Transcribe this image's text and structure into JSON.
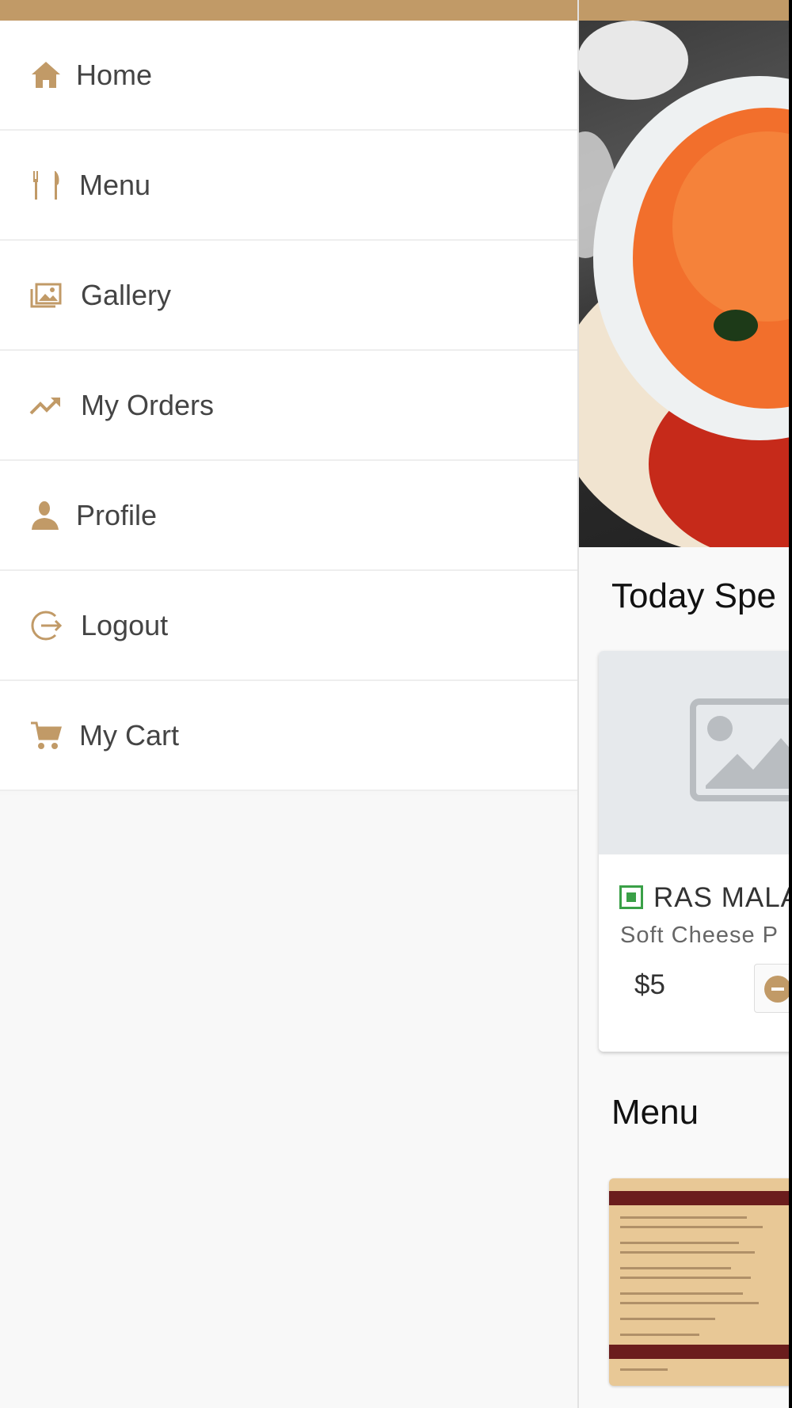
{
  "drawer": {
    "items": [
      {
        "label": "Home",
        "icon": "home-icon"
      },
      {
        "label": "Menu",
        "icon": "cutlery-icon"
      },
      {
        "label": "Gallery",
        "icon": "gallery-icon"
      },
      {
        "label": "My Orders",
        "icon": "trending-up-icon"
      },
      {
        "label": "Profile",
        "icon": "person-icon"
      },
      {
        "label": "Logout",
        "icon": "logout-icon"
      },
      {
        "label": "My Cart",
        "icon": "cart-icon"
      }
    ]
  },
  "main": {
    "specials_title": "Today Spe",
    "special_item": {
      "name": "RAS MALA",
      "description": "Soft Cheese P",
      "price": "$5"
    },
    "menu_title": "Menu"
  },
  "colors": {
    "accent": "#c19a67",
    "veg": "#3aa047"
  }
}
